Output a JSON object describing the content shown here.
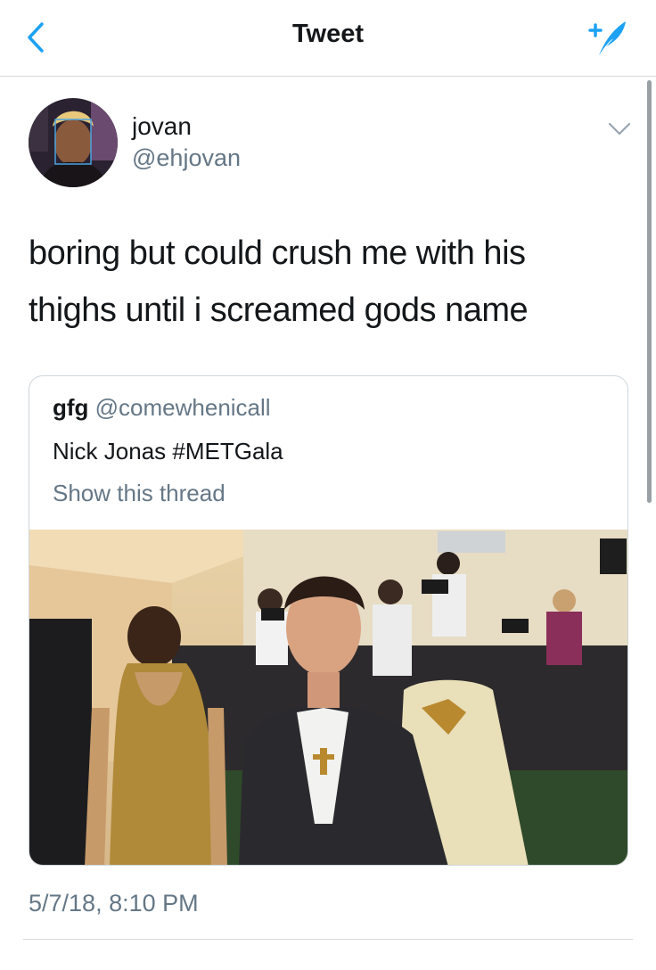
{
  "nav": {
    "title": "Tweet",
    "back_icon": "chevron-left-icon",
    "compose_icon": "compose-feather-icon",
    "accent_color": "#1da1f2"
  },
  "tweet": {
    "author_name": "jovan",
    "author_handle": "@ehjovan",
    "text_line1": "boring but could crush me with his",
    "text_line2": "thighs until i screamed gods name",
    "timestamp": "5/7/18, 8:10 PM"
  },
  "quoted_tweet": {
    "author_name": "gfg",
    "author_handle": "@comewhenicall",
    "text": "Nick Jonas #METGala",
    "show_thread": "Show this thread"
  },
  "colors": {
    "text": "#14171a",
    "secondary": "#657786",
    "border": "#cfd6dc"
  }
}
